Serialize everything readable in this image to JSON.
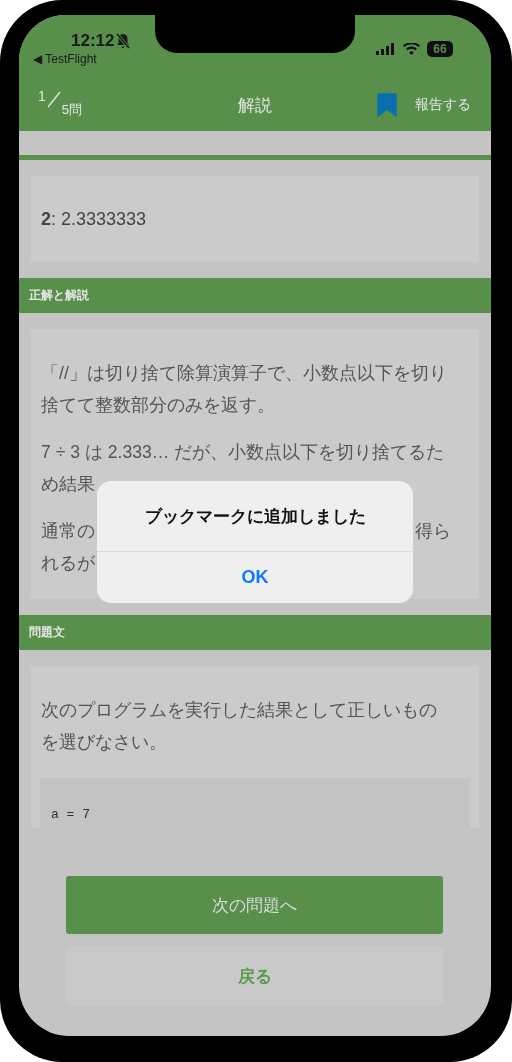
{
  "status_bar": {
    "time": "12:12",
    "back_app": "◀ TestFlight",
    "battery": "66"
  },
  "nav": {
    "counter_current": "1",
    "counter_total": "5問",
    "title": "解説",
    "bookmarked": true,
    "report": "報告する"
  },
  "answer": "**2**: 2.3333333",
  "explanation": {
    "heading": "正解と解説",
    "paragraphs": [
      {
        "kind": "text",
        "text": "「//」は切り捨て除算演算子で、小数点以下を切り捨てて整数部分のみを返す。"
      },
      {
        "kind": "text",
        "text": "7 ÷ 3 は 2.333… だが、小数点以下を切り捨てるため結果"
      },
      {
        "kind": "obscured",
        "left": [
          "通常の",
          "れるが"
        ],
        "right": "得ら"
      }
    ]
  },
  "question": {
    "heading": "問題文",
    "text": "次のプログラムを実行した結果として正しいものを選びなさい。",
    "code": "a = 7"
  },
  "buttons": {
    "next": "次の問題へ",
    "back": "戻る"
  },
  "alert": {
    "title": "ブックマークに追加しました",
    "button": "OK"
  }
}
